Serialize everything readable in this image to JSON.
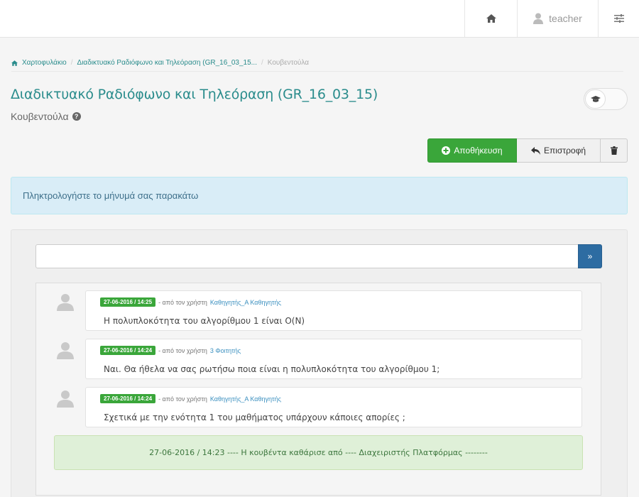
{
  "topbar": {
    "home_icon": "home-icon",
    "username": "teacher",
    "user_icon": "user-icon",
    "settings_icon": "sliders-icon"
  },
  "breadcrumb": {
    "home_label": "Χαρτοφυλάκιο",
    "course_label": "Διαδικτυακό Ραδιόφωνο και Τηλεόραση (GR_16_03_15...",
    "current_label": "Κουβεντούλα",
    "separator": "/"
  },
  "page": {
    "title": "Διαδικτυακό Ραδιόφωνο και Τηλεόραση (GR_16_03_15)",
    "subtitle": "Κουβεντούλα",
    "help_icon": "?"
  },
  "toolbar": {
    "save_label": "Αποθήκευση",
    "back_label": "Επιστροφή",
    "delete_icon": "trash-icon"
  },
  "info_alert": "Πληκτρολογήστε το μήνυμά σας παρακάτω",
  "chat": {
    "input_value": "",
    "send_label": "»",
    "by_text": "- από τον χρήστη",
    "messages": [
      {
        "timestamp": "27-06-2016 / 14:25",
        "user": "Καθηγητής_Α Καθηγητής",
        "text": "Η πολυπλοκότητα του αλγορίθμου 1 είναι O(N)"
      },
      {
        "timestamp": "27-06-2016 / 14:24",
        "user": "3 Φοιτητής",
        "text": "Ναι. Θα ήθελα να σας ρωτήσω ποια είναι η πολυπλοκότητα του αλγορίθμου 1;"
      },
      {
        "timestamp": "27-06-2016 / 14:24",
        "user": "Καθηγητής_Α Καθηγητής",
        "text": "Σχετικά με την ενότητα 1 του μαθήματος υπάρχουν κάποιες απορίες ;"
      }
    ],
    "cleared_notice": "27-06-2016 / 14:23 ---- Η κουβέντα καθάρισε από ---- Διαχειριστής Πλατφόρμας --------"
  },
  "colors": {
    "accent": "#2a8c8c",
    "success": "#3aa63a",
    "primary": "#2d6ca2",
    "info_bg": "#d9edf7",
    "success_bg": "#dff0d8"
  }
}
